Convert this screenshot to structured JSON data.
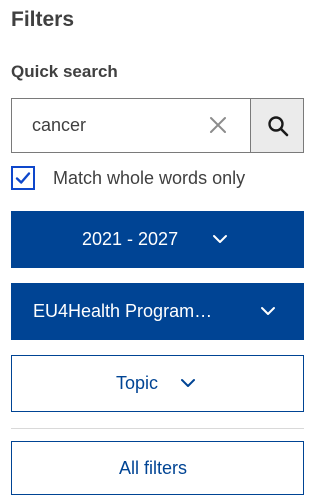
{
  "filters": {
    "title": "Filters",
    "quick_search": {
      "heading": "Quick search",
      "value": "cancer",
      "placeholder": "",
      "clear_icon": "close-icon",
      "search_icon": "search-icon"
    },
    "match_whole_words": {
      "label": "Match whole words only",
      "checked": true
    },
    "period_dropdown": {
      "label": "2021 - 2027",
      "icon": "chevron-down-icon"
    },
    "programme_dropdown": {
      "label": "EU4Health Program…",
      "icon": "chevron-down-icon"
    },
    "topic_dropdown": {
      "label": "Topic",
      "icon": "chevron-down-icon"
    },
    "all_filters_button": {
      "label": "All filters"
    }
  },
  "colors": {
    "primary_blue": "#004494",
    "checkbox_blue": "#0e47cb",
    "text_gray": "#404040",
    "search_button_bg": "#ebebeb",
    "divider": "#d9d9d9"
  }
}
